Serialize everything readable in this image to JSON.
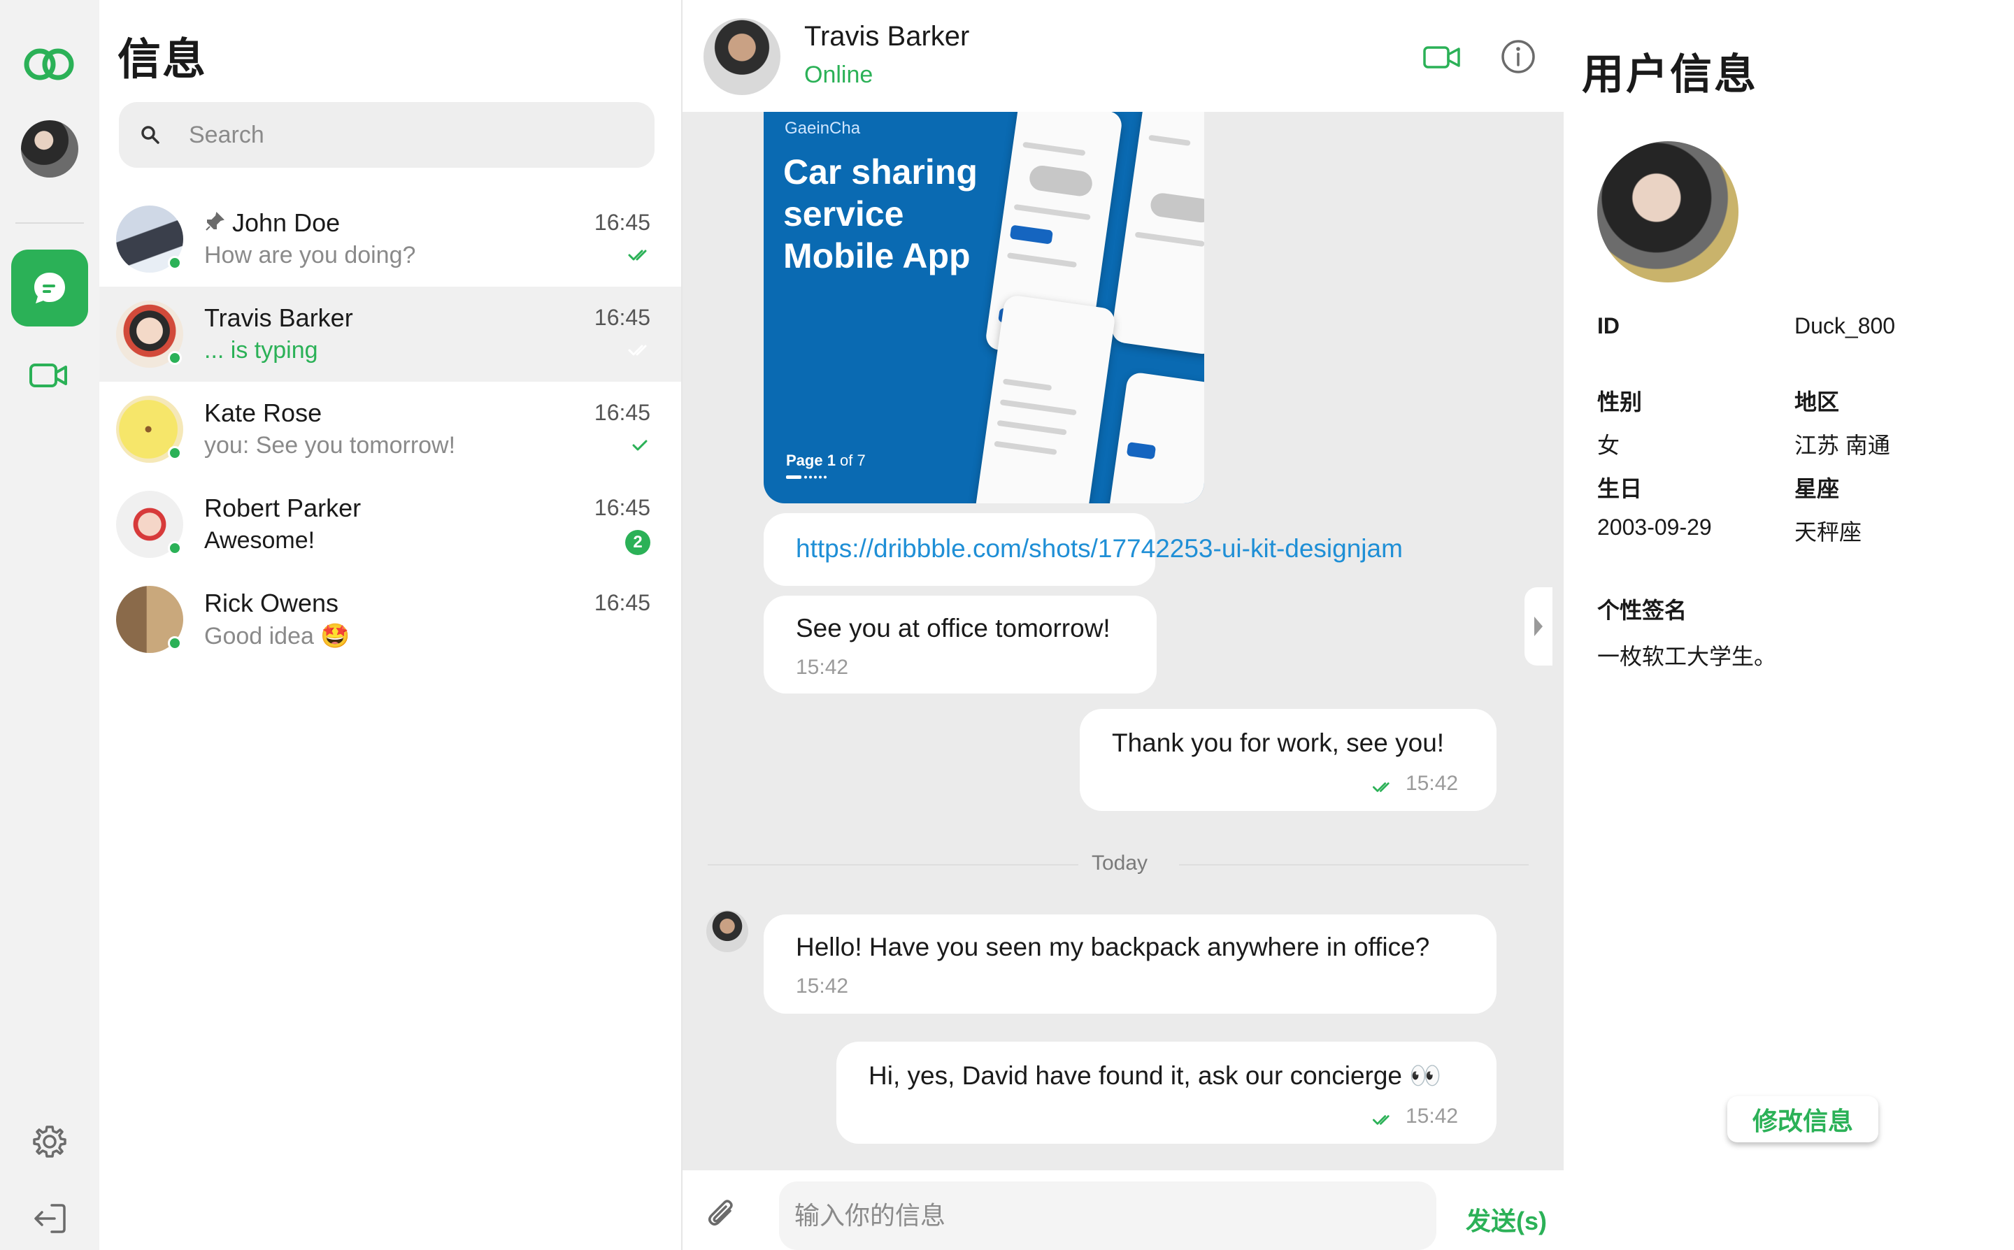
{
  "sidebar": {
    "logo_icon": "double-ring-logo-icon",
    "accent": "#2bb157"
  },
  "list": {
    "title": "信息",
    "search_placeholder": "Search",
    "conversations": [
      {
        "name": "John Doe",
        "message": "How are you doing?",
        "time": "16:45",
        "pinned": true,
        "status": "read"
      },
      {
        "name": "Travis Barker",
        "message": "... is typing",
        "time": "16:45",
        "typing": true,
        "status": "read"
      },
      {
        "name": "Kate Rose",
        "message": "you: See you tomorrow!",
        "time": "16:45",
        "status": "sent"
      },
      {
        "name": "Robert Parker",
        "message": "Awesome!",
        "time": "16:45",
        "unread": "2"
      },
      {
        "name": "Rick Owens",
        "message": "Good idea 🤩",
        "time": "16:45"
      }
    ]
  },
  "chat": {
    "contact_name": "Travis Barker",
    "contact_status": "Online",
    "image_card": {
      "brand": "GaeinCha",
      "title": "Car sharing service Mobile App",
      "page_bold": "Page 1",
      "page_rest": " of 7"
    },
    "messages": [
      {
        "text": "https://dribbble.com/shots/17742253-ui-kit-designjam"
      },
      {
        "text": "See you at office tomorrow!",
        "time": "15:42"
      },
      {
        "text": "Thank you for work, see you!",
        "time": "15:42"
      },
      {
        "text": "Hello! Have you seen my backpack anywhere in office?",
        "time": "15:42"
      },
      {
        "text": "Hi, yes, David have found it, ask our concierge 👀",
        "time": "15:42"
      }
    ],
    "divider": "Today",
    "composer_placeholder": "输入你的信息",
    "send_label": "发送(s)"
  },
  "profile": {
    "title": "用户信息",
    "id_label": "ID",
    "id_value": "Duck_800",
    "gender_label": "性别",
    "gender_value": "女",
    "region_label": "地区",
    "region_value": "江苏 南通",
    "birthday_label": "生日",
    "birthday_value": "2003-09-29",
    "zodiac_label": "星座",
    "zodiac_value": "天秤座",
    "signature_label": "个性签名",
    "signature_value": "一枚软工大学生。",
    "edit_label": "修改信息"
  }
}
